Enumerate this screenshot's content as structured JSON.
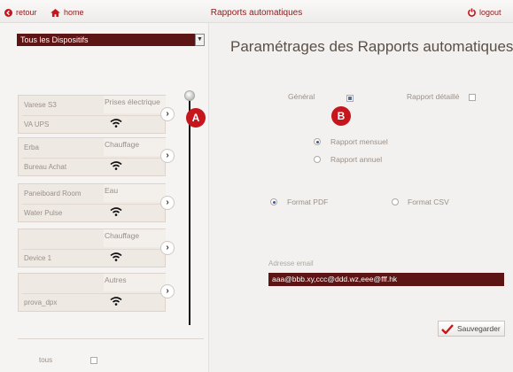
{
  "topbar": {
    "back_label": "retour",
    "home_label": "home",
    "title": "Rapports automatiques",
    "logout_label": "logout"
  },
  "left": {
    "device_filter": "Tous les Dispositifs",
    "devices": [
      {
        "name1": "Varese S3",
        "category": "Prises électrique",
        "name2": "VA UPS"
      },
      {
        "name1": "Erba",
        "category": "Chauffage",
        "name2": "Bureau Achat"
      },
      {
        "name1": "Paneiboard Room",
        "category": "Eau",
        "name2": "Water Pulse"
      },
      {
        "name1": "",
        "category": "Chauffage",
        "name2": "Device 1"
      },
      {
        "name1": "",
        "category": "Autres",
        "name2": "prova_dpx"
      }
    ],
    "all_label": "tous",
    "all_checked": false
  },
  "markers": {
    "a": "A",
    "b": "B"
  },
  "settings": {
    "title": "Paramétrages des Rapports automatiques",
    "general_label": "Général",
    "general_checked": true,
    "detailed_label": "Rapport détaillé",
    "detailed_checked": false,
    "report_monthly": "Rapport mensuel",
    "report_yearly": "Rapport annuel",
    "selected_period": "monthly",
    "format_pdf": "Format PDF",
    "format_csv": "Format CSV",
    "selected_format": "pdf",
    "email_label": "Adresse email",
    "email_value": "aaa@bbb.xy,ccc@ddd.wz,eee@fff.hk",
    "save_label": "Sauvegarder"
  },
  "colors": {
    "brand": "#8b1a1a",
    "dark_field": "#5c1414",
    "marker": "#c4161c"
  }
}
